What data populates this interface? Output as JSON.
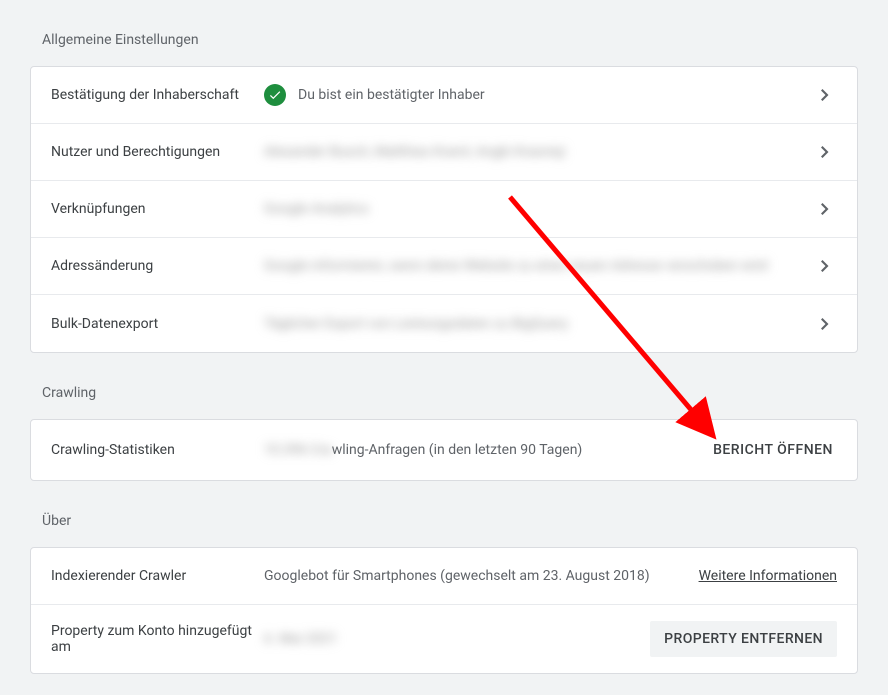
{
  "sections": {
    "general": {
      "title": "Allgemeine Einstellungen",
      "rows": {
        "ownership": {
          "label": "Bestätigung der Inhaberschaft",
          "status_text": "Du bist ein bestätigter Inhaber"
        },
        "users": {
          "label": "Nutzer und Berechtigungen",
          "value_blurred": "Alexander Busch, Matthias Kraml, Angki Krasniqi"
        },
        "associations": {
          "label": "Verknüpfungen",
          "value_blurred": "Google Analytics"
        },
        "address_change": {
          "label": "Adressänderung",
          "value_blurred": "Google informieren, wenn deine Website zu einer neuen Adresse verschoben wird"
        },
        "bulk_export": {
          "label": "Bulk-Datenexport",
          "value_blurred": "Täglicher Export von Leistungsdaten zu BigQuery"
        }
      }
    },
    "crawling": {
      "title": "Crawling",
      "rows": {
        "stats": {
          "label": "Crawling-Statistiken",
          "prefix_blurred": "10.396 Cra",
          "value": "wling-Anfragen (in den letzten 90 Tagen)",
          "action_label": "BERICHT ÖFFNEN"
        }
      }
    },
    "about": {
      "title": "Über",
      "rows": {
        "crawler": {
          "label": "Indexierender Crawler",
          "value": "Googlebot für Smartphones (gewechselt am 23. August 2018)",
          "action_label": "Weitere Informationen"
        },
        "property_added": {
          "label": "Property zum Konto hinzugefügt am",
          "value_blurred": "6. Mai 2021",
          "action_label": "PROPERTY ENTFERNEN"
        }
      }
    }
  },
  "colors": {
    "success": "#1e8e3e",
    "annotation": "#ff0000"
  }
}
